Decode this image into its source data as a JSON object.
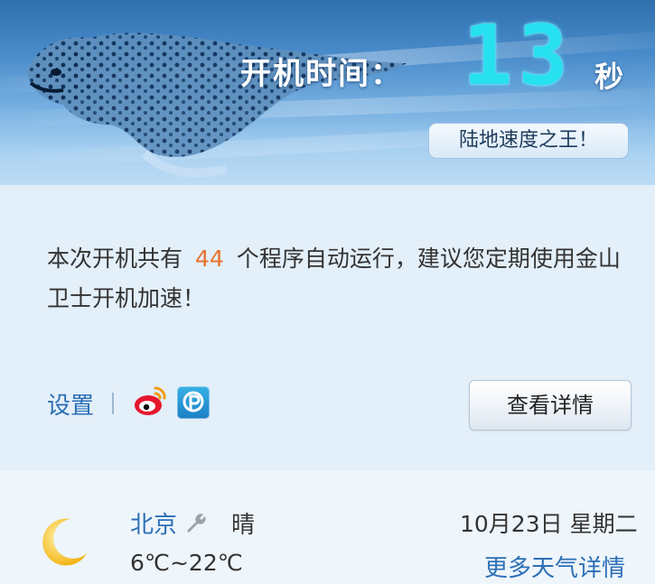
{
  "banner": {
    "boot_time_label": "开机时间：",
    "boot_seconds": "13",
    "seconds_unit": "秒",
    "rank_badge": "陆地速度之王！"
  },
  "info": {
    "message_prefix": "本次开机共有",
    "program_count": "44",
    "message_suffix": "个程序自动运行，建议您定期使用金山卫士开机加速！",
    "settings_label": "设置",
    "details_button": "查看详情"
  },
  "weather": {
    "city": "北京",
    "condition": "晴",
    "temperature_range": "6℃~22℃",
    "date": "10月23日 星期二",
    "more_details": "更多天气详情"
  },
  "icons": {
    "weibo": "weibo-icon",
    "pengyou": "pengyou-p-icon",
    "moon": "moon-icon",
    "wrench": "wrench-icon"
  },
  "colors": {
    "digits": "#27e0f0",
    "count_highlight": "#e8722f",
    "link": "#2c6fb6"
  }
}
